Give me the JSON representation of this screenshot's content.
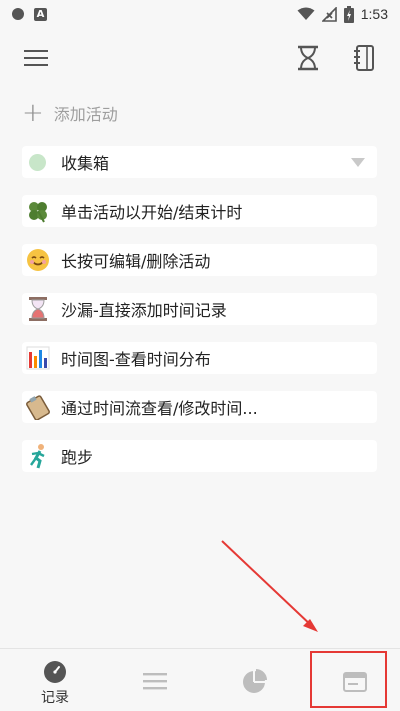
{
  "status_bar": {
    "time": "1:53",
    "icons": [
      "circle-notification-icon",
      "a-notification-icon",
      "wifi-icon",
      "no-signal-icon",
      "battery-charging-icon"
    ]
  },
  "toolbar": {
    "icons": [
      "menu-icon",
      "hourglass-icon",
      "notebook-icon"
    ]
  },
  "add_activity": {
    "label": "添加活动",
    "icon": "plus-icon"
  },
  "category": {
    "label": "收集箱",
    "dot_color": "#c8e6c9",
    "icon": "dropdown-caret-icon"
  },
  "activities": [
    {
      "label": "单击活动以开始/结束计时",
      "icon": "clover-icon"
    },
    {
      "label": "长按可编辑/删除活动",
      "icon": "smiley-icon"
    },
    {
      "label": "沙漏-直接添加时间记录",
      "icon": "hourglass-icon"
    },
    {
      "label": "时间图-查看时间分布",
      "icon": "bar-chart-icon"
    },
    {
      "label": "通过时间流查看/修改时间...",
      "icon": "clipboard-icon"
    },
    {
      "label": "跑步",
      "icon": "runner-icon"
    }
  ],
  "bottom_nav": {
    "record_label": "记录",
    "tabs": [
      "record-tab",
      "list-tab",
      "pie-chart-tab",
      "calendar-tab"
    ]
  },
  "colors": {
    "annotation_red": "#e53935",
    "background": "#f7f7f7",
    "row_bg": "#ffffff"
  }
}
